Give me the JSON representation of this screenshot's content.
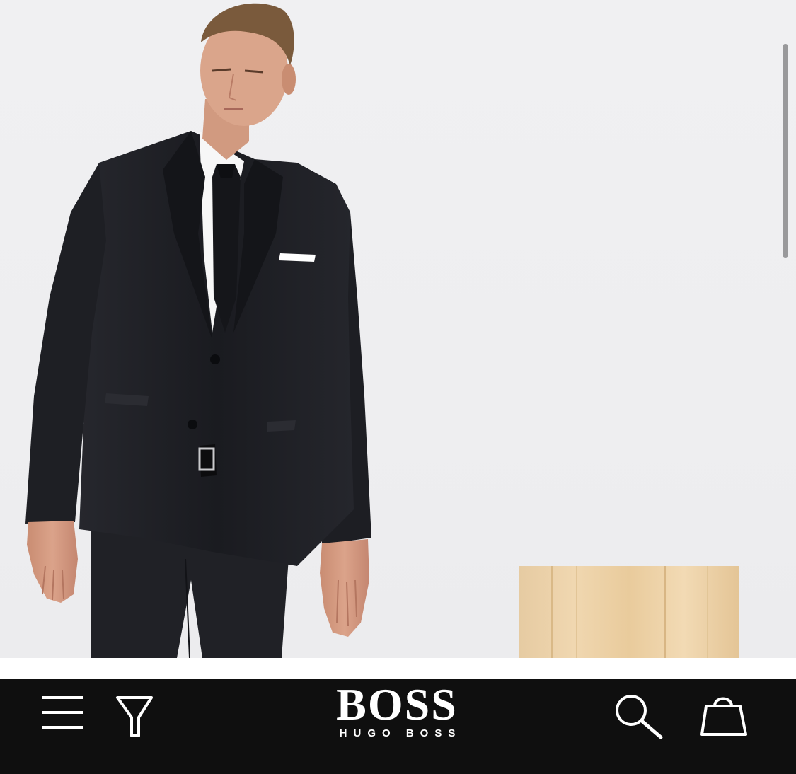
{
  "hero": {
    "image_subject": "model-in-black-suit",
    "background_color": "#efeff1",
    "suit_color": "#1b1c21",
    "shirt_color": "#f6f6f6",
    "plinth_color": "#e8c99a"
  },
  "navbar": {
    "background_color": "#0f0f0f",
    "icon_color": "#ffffff",
    "menu_icon": "hamburger-menu-icon",
    "filter_icon": "filter-funnel-icon",
    "search_icon": "magnifier-icon",
    "bag_icon": "shopping-bag-icon"
  },
  "logo": {
    "main": "BOSS",
    "sub": "HUGO BOSS"
  }
}
